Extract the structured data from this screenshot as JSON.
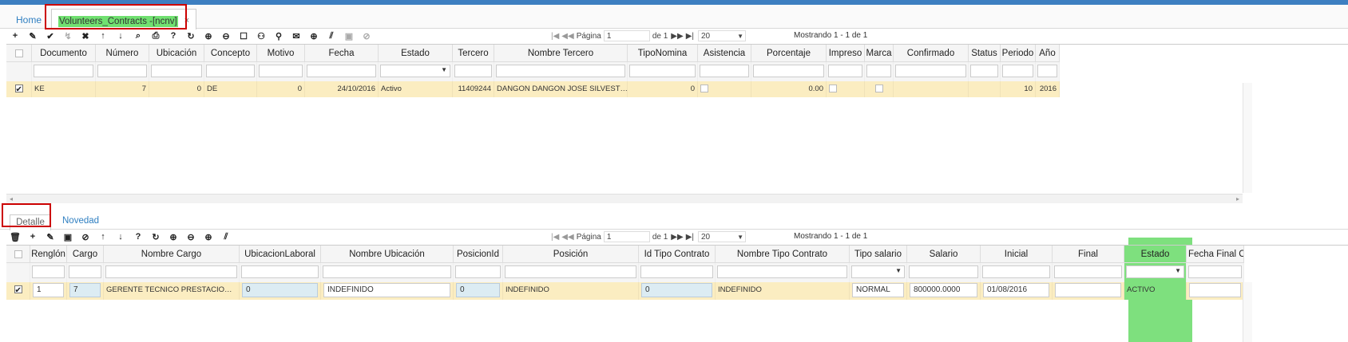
{
  "tabs": {
    "home": "Home",
    "active": "Volunteers_Contracts -[ncnv]",
    "close": "×"
  },
  "toolbar1": {
    "icons": [
      "add-icon",
      "edit-icon",
      "check-icon",
      "disabled-check-icon",
      "delete-icon",
      "arrow-up-icon",
      "arrow-down-icon",
      "search-icon",
      "print-icon",
      "help-icon",
      "refresh-icon",
      "zoom-in-icon",
      "zoom-out-icon",
      "comment-icon",
      "user-icon",
      "pin-icon",
      "mail-icon",
      "plus-circle-icon",
      "resize-icon",
      "save-icon",
      "cancel-icon"
    ]
  },
  "pager1": {
    "first": "|◀",
    "prev": "◀◀",
    "page_label": "Página",
    "page": "1",
    "of": "de 1",
    "next": "▶▶",
    "last": "▶|",
    "size": "20",
    "showing": "Mostrando 1 - 1 de 1"
  },
  "grid1": {
    "headers": [
      "Documento",
      "Número",
      "Ubicación",
      "Concepto",
      "Motivo",
      "Fecha",
      "Estado",
      "Tercero",
      "Nombre Tercero",
      "TipoNomina",
      "Asistencia",
      "Porcentaje",
      "Impreso",
      "Marca",
      "Confirmado",
      "Status",
      "Periodo",
      "Año"
    ],
    "row": {
      "documento": "KE",
      "numero": "7",
      "ubicacion": "0",
      "concepto": "DE",
      "motivo": "0",
      "fecha": "24/10/2016",
      "estado": "Activo",
      "tercero": "11409244",
      "nombre_tercero": "DANGON DANGON JOSE SILVEST…",
      "tiponomina": "0",
      "porcentaje": "0.00",
      "periodo": "10",
      "anio": "2016"
    }
  },
  "subtabs": {
    "detalle": "Detalle",
    "novedad": "Novedad"
  },
  "pager2": {
    "first": "|◀",
    "prev": "◀◀",
    "page_label": "Página",
    "page": "1",
    "of": "de 1",
    "next": "▶▶",
    "last": "▶|",
    "size": "20",
    "showing": "Mostrando 1 - 1 de 1"
  },
  "grid2": {
    "headers": [
      "Renglón",
      "Cargo",
      "Nombre Cargo",
      "UbicacionLaboral",
      "Nombre Ubicación",
      "PosicionId",
      "Posición",
      "Id Tipo Contrato",
      "Nombre Tipo Contrato",
      "Tipo salario",
      "Salario",
      "Inicial",
      "Final",
      "Estado",
      "Fecha Final Co"
    ],
    "row": {
      "renglon": "1",
      "cargo": "7",
      "nombre_cargo": "GERENTE TECNICO PRESTACIO…",
      "ubicacion_laboral": "0",
      "nombre_ubicacion": "INDEFINIDO",
      "posicion_id": "0",
      "posicion": "INDEFINIDO",
      "id_tipo_contrato": "0",
      "nombre_tipo_contrato": "INDEFINIDO",
      "tipo_salario": "NORMAL",
      "salario": "800000.0000",
      "inicial": "01/08/2016",
      "final": "",
      "estado": "ACTIVO"
    }
  },
  "colors": {
    "accent": "#3d7fc1",
    "highlight": "#70e070",
    "selected_row": "#fbedc1",
    "annotation": "#cc0000"
  }
}
